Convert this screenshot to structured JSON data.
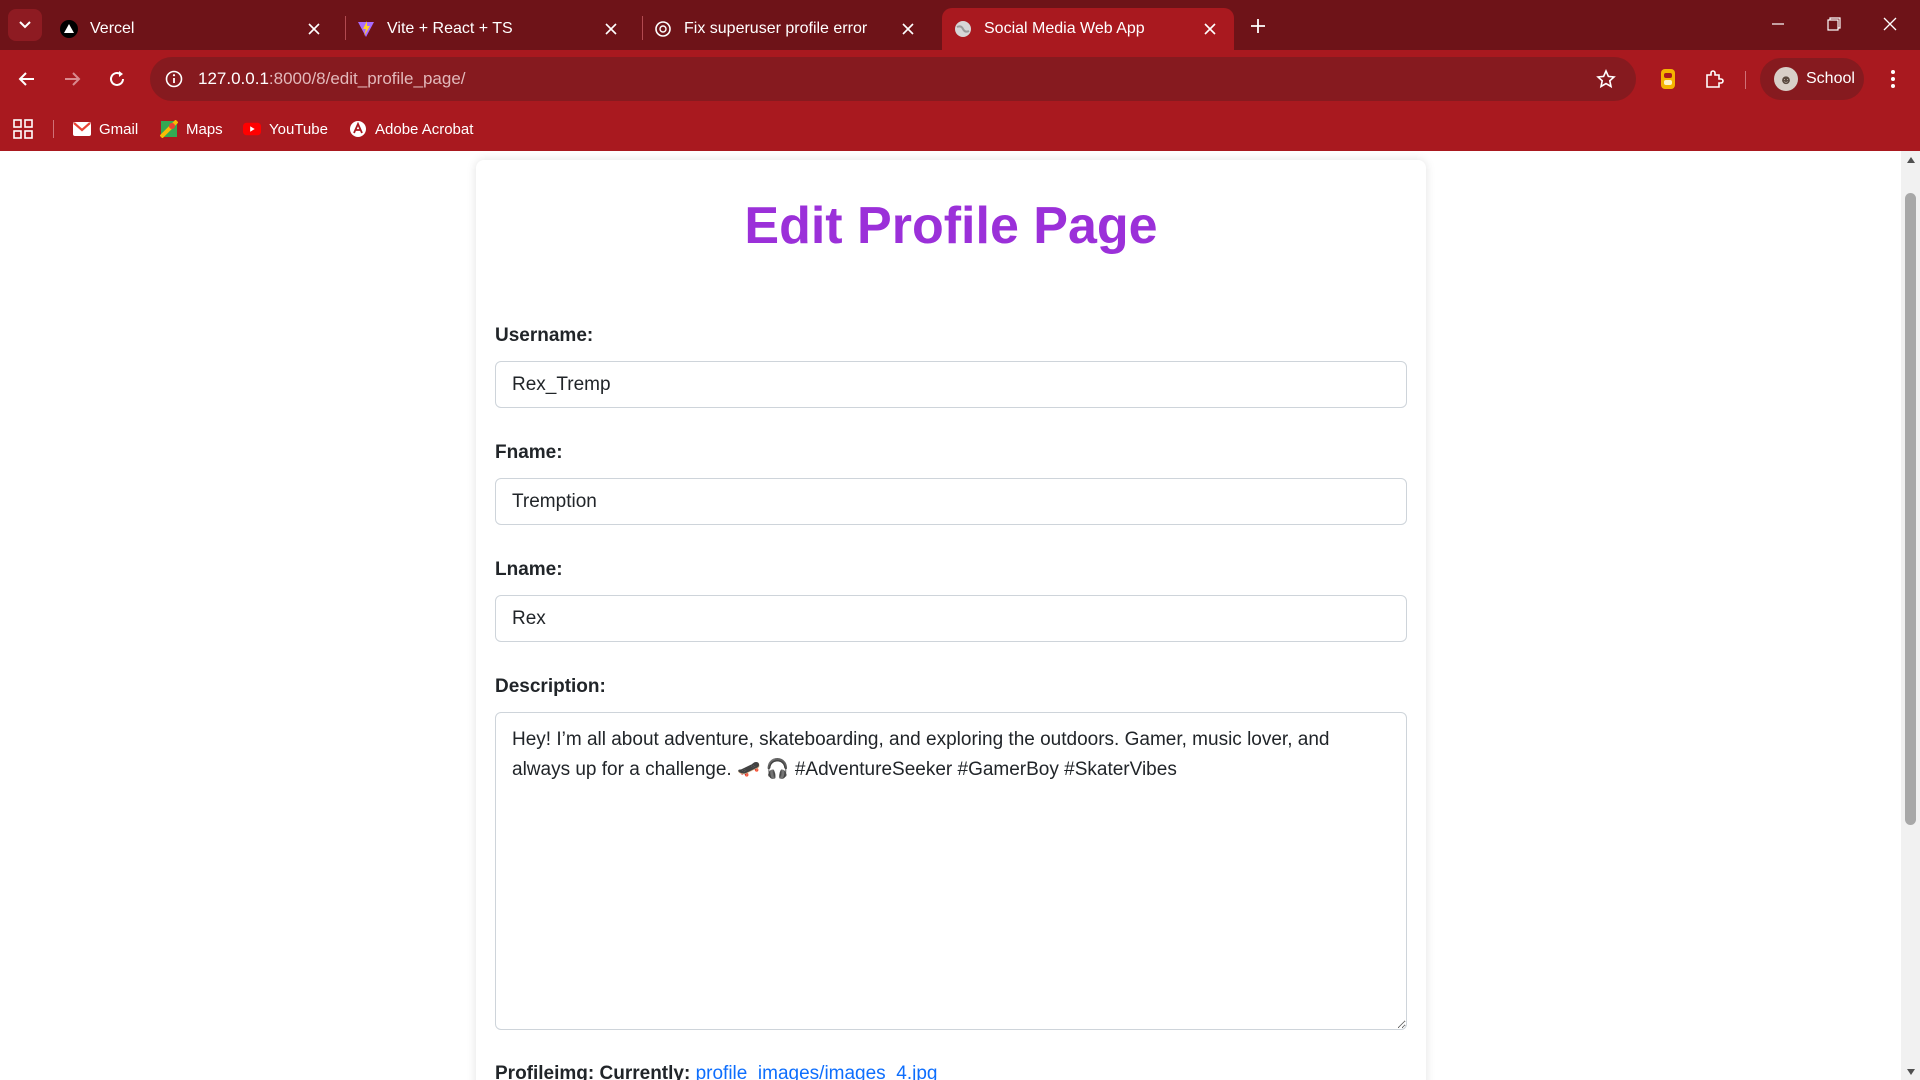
{
  "browser": {
    "tabs": [
      {
        "title": "Vercel",
        "favicon": "vercel-triangle-icon"
      },
      {
        "title": "Vite + React + TS",
        "favicon": "vite-icon"
      },
      {
        "title": "Fix superuser profile error",
        "favicon": "chatgpt-icon"
      },
      {
        "title": "Social Media Web App",
        "favicon": "globe-icon",
        "active": true
      }
    ],
    "url_host": "127.0.0.1",
    "url_path": ":8000/8/edit_profile_page/",
    "profile_label": "School",
    "bookmarks": [
      {
        "label": "Gmail",
        "icon": "gmail-icon"
      },
      {
        "label": "Maps",
        "icon": "maps-icon"
      },
      {
        "label": "YouTube",
        "icon": "youtube-icon"
      },
      {
        "label": "Adobe Acrobat",
        "icon": "acrobat-icon"
      }
    ]
  },
  "page": {
    "title": "Edit Profile Page",
    "fields": {
      "username": {
        "label": "Username:",
        "value": "Rex_Tremp"
      },
      "fname": {
        "label": "Fname:",
        "value": "Tremption"
      },
      "lname": {
        "label": "Lname:",
        "value": "Rex"
      },
      "description": {
        "label": "Description:",
        "value": "Hey! I’m all about adventure, skateboarding, and exploring the outdoors. Gamer, music lover, and always up for a challenge. 🛹 🎧 #AdventureSeeker #GamerBoy #SkaterVibes"
      }
    },
    "profileimg": {
      "label": "Profileimg:",
      "currently": "Currently:",
      "link_text": "profile_images/images_4.jpg"
    }
  },
  "colors": {
    "tabstrip": "#6e1318",
    "toolbar": "#a9191f",
    "title_purple": "#9b30d9",
    "link_blue": "#0d6efd"
  }
}
